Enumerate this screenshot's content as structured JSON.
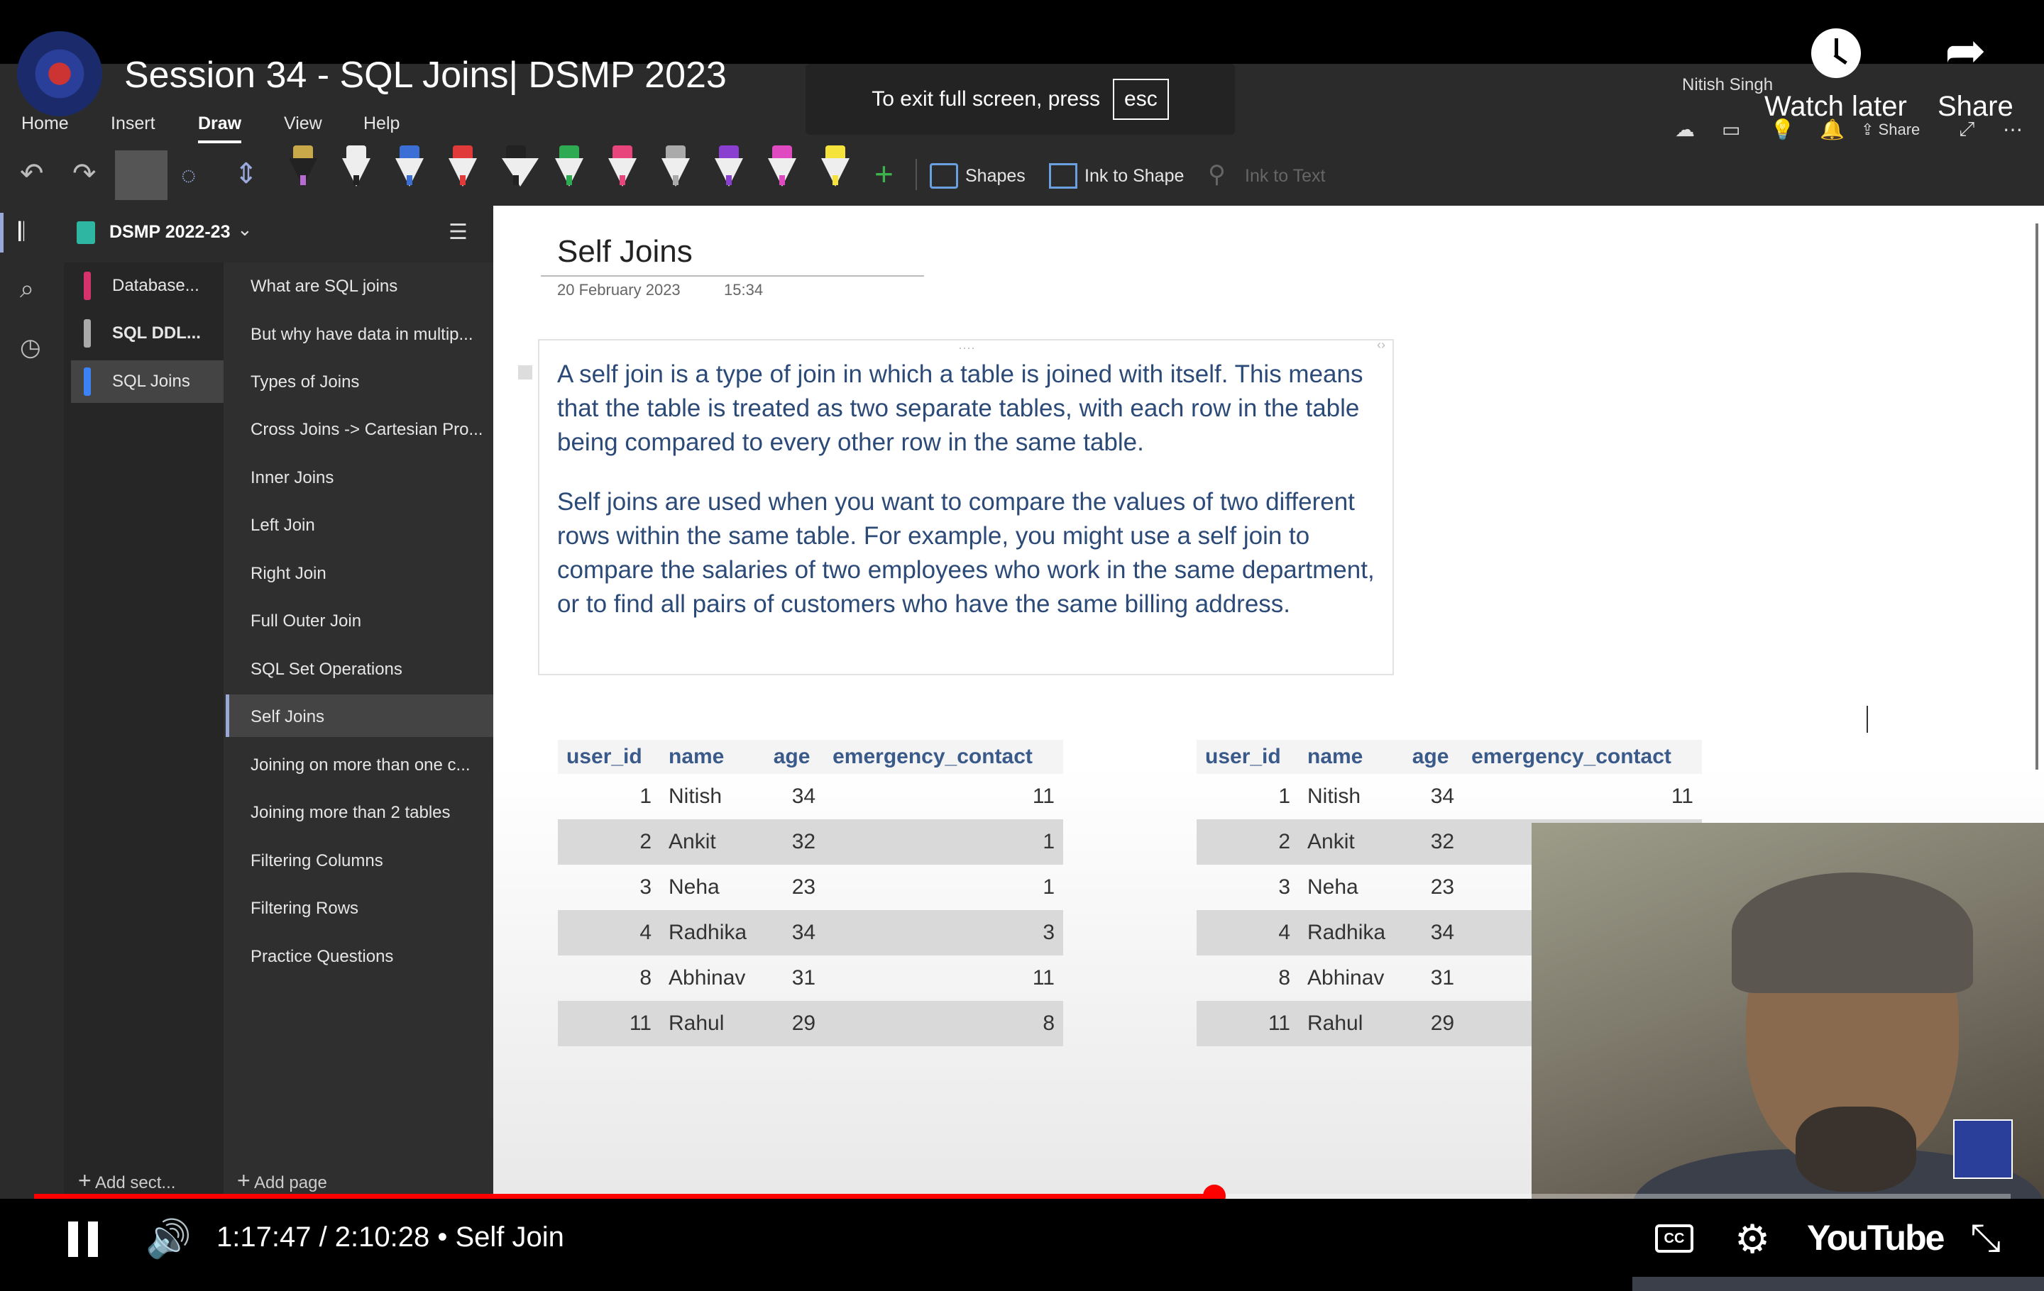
{
  "video": {
    "title": "Session 34 - SQL Joins| DSMP 2023",
    "fullscreen_hint": "To exit full screen, press",
    "fullscreen_key": "esc",
    "watch_later": "Watch later",
    "share": "Share",
    "time": "1:17:47 / 2:10:28 • Self Join",
    "progress": 0.597,
    "brand": "YouTube"
  },
  "onenote": {
    "user": "Nitish Singh",
    "share_label": "Share",
    "tabs": [
      "Home",
      "Insert",
      "Draw",
      "View",
      "Help"
    ],
    "active_tab": "Draw",
    "tools": {
      "shapes": "Shapes",
      "ink_to_shape": "Ink to Shape",
      "ink_to_text": "Ink to Text"
    },
    "notebook": "DSMP 2022-23",
    "sections": [
      {
        "label": "Database...",
        "color": "#d6336c"
      },
      {
        "label": "SQL DDL...",
        "color": "#aaaaaa"
      },
      {
        "label": "SQL Joins",
        "color": "#3b82f6"
      }
    ],
    "pages": [
      "What are SQL joins",
      "But why have data in multip...",
      "Types of Joins",
      "Cross Joins -> Cartesian Pro...",
      "Inner Joins",
      "Left Join",
      "Right Join",
      "Full Outer Join",
      "SQL Set Operations",
      "Self Joins",
      "Joining on more than one c...",
      "Joining more than 2 tables",
      "Filtering Columns",
      "Filtering Rows",
      "Practice Questions"
    ],
    "active_page_index": 9,
    "add_section": "Add sect...",
    "add_page": "Add page",
    "page": {
      "title": "Self Joins",
      "date": "20 February 2023",
      "time": "15:34",
      "paragraphs": [
        "A self join is a type of join in which a table is joined with itself. This means that the table is treated as two separate tables, with each row in the table being compared to every other row in the same table.",
        "Self joins are used when you want to compare the values of two different rows within the same table. For example, you might use a self join to compare the salaries of two employees who work in the same department, or to find all pairs of customers who have the same billing address."
      ],
      "table_headers": [
        "user_id",
        "name",
        "age",
        "emergency_contact"
      ],
      "table_left": [
        [
          "1",
          "Nitish",
          "34",
          "11"
        ],
        [
          "2",
          "Ankit",
          "32",
          "1"
        ],
        [
          "3",
          "Neha",
          "23",
          "1"
        ],
        [
          "4",
          "Radhika",
          "34",
          "3"
        ],
        [
          "8",
          "Abhinav",
          "31",
          "11"
        ],
        [
          "11",
          "Rahul",
          "29",
          "8"
        ]
      ],
      "table_right": [
        [
          "1",
          "Nitish",
          "34",
          "11"
        ],
        [
          "2",
          "Ankit",
          "32",
          ""
        ],
        [
          "3",
          "Neha",
          "23",
          ""
        ],
        [
          "4",
          "Radhika",
          "34",
          ""
        ],
        [
          "8",
          "Abhinav",
          "31",
          ""
        ],
        [
          "11",
          "Rahul",
          "29",
          ""
        ]
      ]
    }
  }
}
